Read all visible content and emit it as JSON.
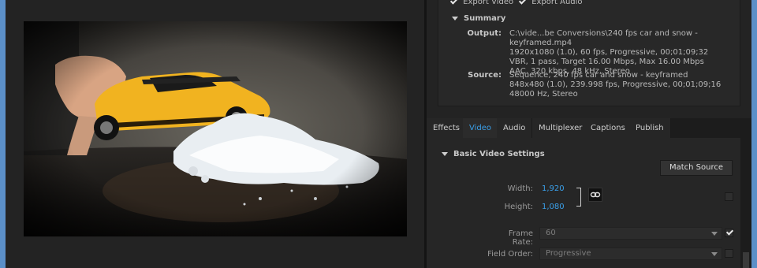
{
  "export_options": {
    "export_video_label": "Export Video",
    "export_audio_label": "Export Audio"
  },
  "summary": {
    "title": "Summary",
    "output_label": "Output:",
    "output_lines": [
      "C:\\vide...be Conversions\\240 fps car and snow - keyframed.mp4",
      "1920x1080 (1.0), 60 fps, Progressive, 00;01;09;32",
      "VBR, 1 pass, Target 16.00 Mbps, Max 16.00 Mbps",
      "AAC, 320 kbps, 48 kHz, Stereo"
    ],
    "source_label": "Source:",
    "source_lines": [
      "Sequence, 240 fps car and snow - keyframed",
      "848x480 (1.0), 239.998 fps, Progressive, 00;01;09;16",
      "48000 Hz, Stereo"
    ]
  },
  "tabs": [
    "Effects",
    "Video",
    "Audio",
    "Multiplexer",
    "Captions",
    "Publish"
  ],
  "active_tab": "Video",
  "basic_video": {
    "title": "Basic Video Settings",
    "match_source_label": "Match Source",
    "width_label": "Width:",
    "width_value": "1,920",
    "height_label": "Height:",
    "height_value": "1,080",
    "frame_rate_label": "Frame Rate:",
    "frame_rate_value": "60",
    "field_order_label": "Field Order:",
    "field_order_value": "Progressive"
  },
  "colors": {
    "accent": "#3a9fe8",
    "window_frame": "#5b8fc8",
    "panel_bg": "#232323"
  }
}
